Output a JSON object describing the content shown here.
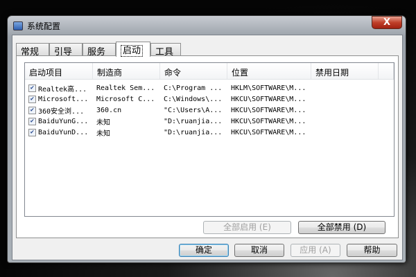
{
  "window": {
    "title": "系统配置",
    "close": "X"
  },
  "tabs": [
    {
      "label": "常规"
    },
    {
      "label": "引导"
    },
    {
      "label": "服务"
    },
    {
      "label": "启动"
    },
    {
      "label": "工具"
    }
  ],
  "columns": [
    "启动项目",
    "制造商",
    "命令",
    "位置",
    "禁用日期"
  ],
  "rows": [
    {
      "checked": true,
      "item": "Realtek高...",
      "maker": "Realtek Sem...",
      "command": "C:\\Program ...",
      "location": "HKLM\\SOFTWARE\\M...",
      "date": ""
    },
    {
      "checked": true,
      "item": "Microsoft...",
      "maker": "Microsoft C...",
      "command": "C:\\Windows\\...",
      "location": "HKCU\\SOFTWARE\\M...",
      "date": ""
    },
    {
      "checked": true,
      "item": "360安全浏...",
      "maker": "360.cn",
      "command": "\"C:\\Users\\A...",
      "location": "HKCU\\SOFTWARE\\M...",
      "date": ""
    },
    {
      "checked": true,
      "item": "BaiduYunG...",
      "maker": "未知",
      "command": "\"D:\\ruanjia...",
      "location": "HKCU\\SOFTWARE\\M...",
      "date": ""
    },
    {
      "checked": true,
      "item": "BaiduYunD...",
      "maker": "未知",
      "command": "\"D:\\ruanjia...",
      "location": "HKCU\\SOFTWARE\\M...",
      "date": ""
    }
  ],
  "buttons": {
    "enable_all": "全部启用 (E)",
    "disable_all": "全部禁用 (D)",
    "ok": "确定",
    "cancel": "取消",
    "apply": "应用 (A)",
    "help": "帮助"
  }
}
